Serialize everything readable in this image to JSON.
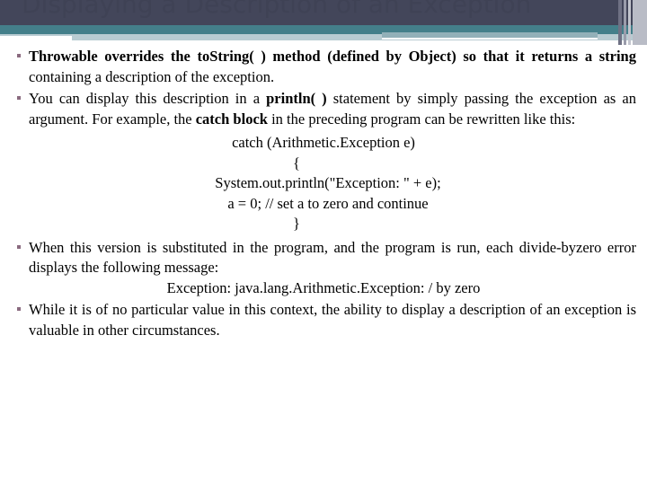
{
  "slide": {
    "title": "Displaying a Description of an Exception",
    "colors": {
      "title_text": "#3f4255",
      "header_navy": "#43465a",
      "header_teal": "#447f8a",
      "header_pale": "#b9ccd2",
      "header_accent": "#92b0b8",
      "bullet_marker": "#8a6a7f",
      "body_text": "#000000",
      "background": "#ffffff"
    },
    "bullets": [
      {
        "id": "bullet-1",
        "segments": [
          {
            "text": "Throwable overrides the to",
            "bold": true
          },
          {
            "text": "String( ) method (defined by Object) so that it ",
            "bold": true
          },
          {
            "text": "returns a string",
            "bold": true
          },
          {
            "text": " containing a description of the exception.",
            "bold": false
          }
        ]
      },
      {
        "id": "bullet-2",
        "segments": [
          {
            "text": "You can display this description in a ",
            "bold": false
          },
          {
            "text": "println( )",
            "bold": true
          },
          {
            "text": " statement by simply passing the exception as an argument. For example, the ",
            "bold": false
          },
          {
            "text": "catch block",
            "bold": true
          },
          {
            "text": " in the preceding program can be rewritten like this:",
            "bold": false
          }
        ]
      },
      {
        "id": "bullet-3",
        "segments": [
          {
            "text": "When this version is substituted in the program, and the program is run, each divide-byzero error displays the following message:",
            "bold": false
          }
        ]
      },
      {
        "id": "bullet-4",
        "segments": [
          {
            "text": "While it is of no particular value in this context, the ability to display a description of an exception is valuable in other circumstances.",
            "bold": false
          }
        ]
      }
    ],
    "code_block": {
      "lines": [
        "catch (Arithmetic.Exception e)",
        "{",
        "System.out.println(\"Exception: \" + e);",
        "a = 0; // set a to zero and continue",
        "}"
      ],
      "indents": [
        0,
        -60,
        10,
        10,
        -60
      ]
    },
    "output_line": "Exception: java.lang.Arithmetic.Exception: / by zero"
  }
}
